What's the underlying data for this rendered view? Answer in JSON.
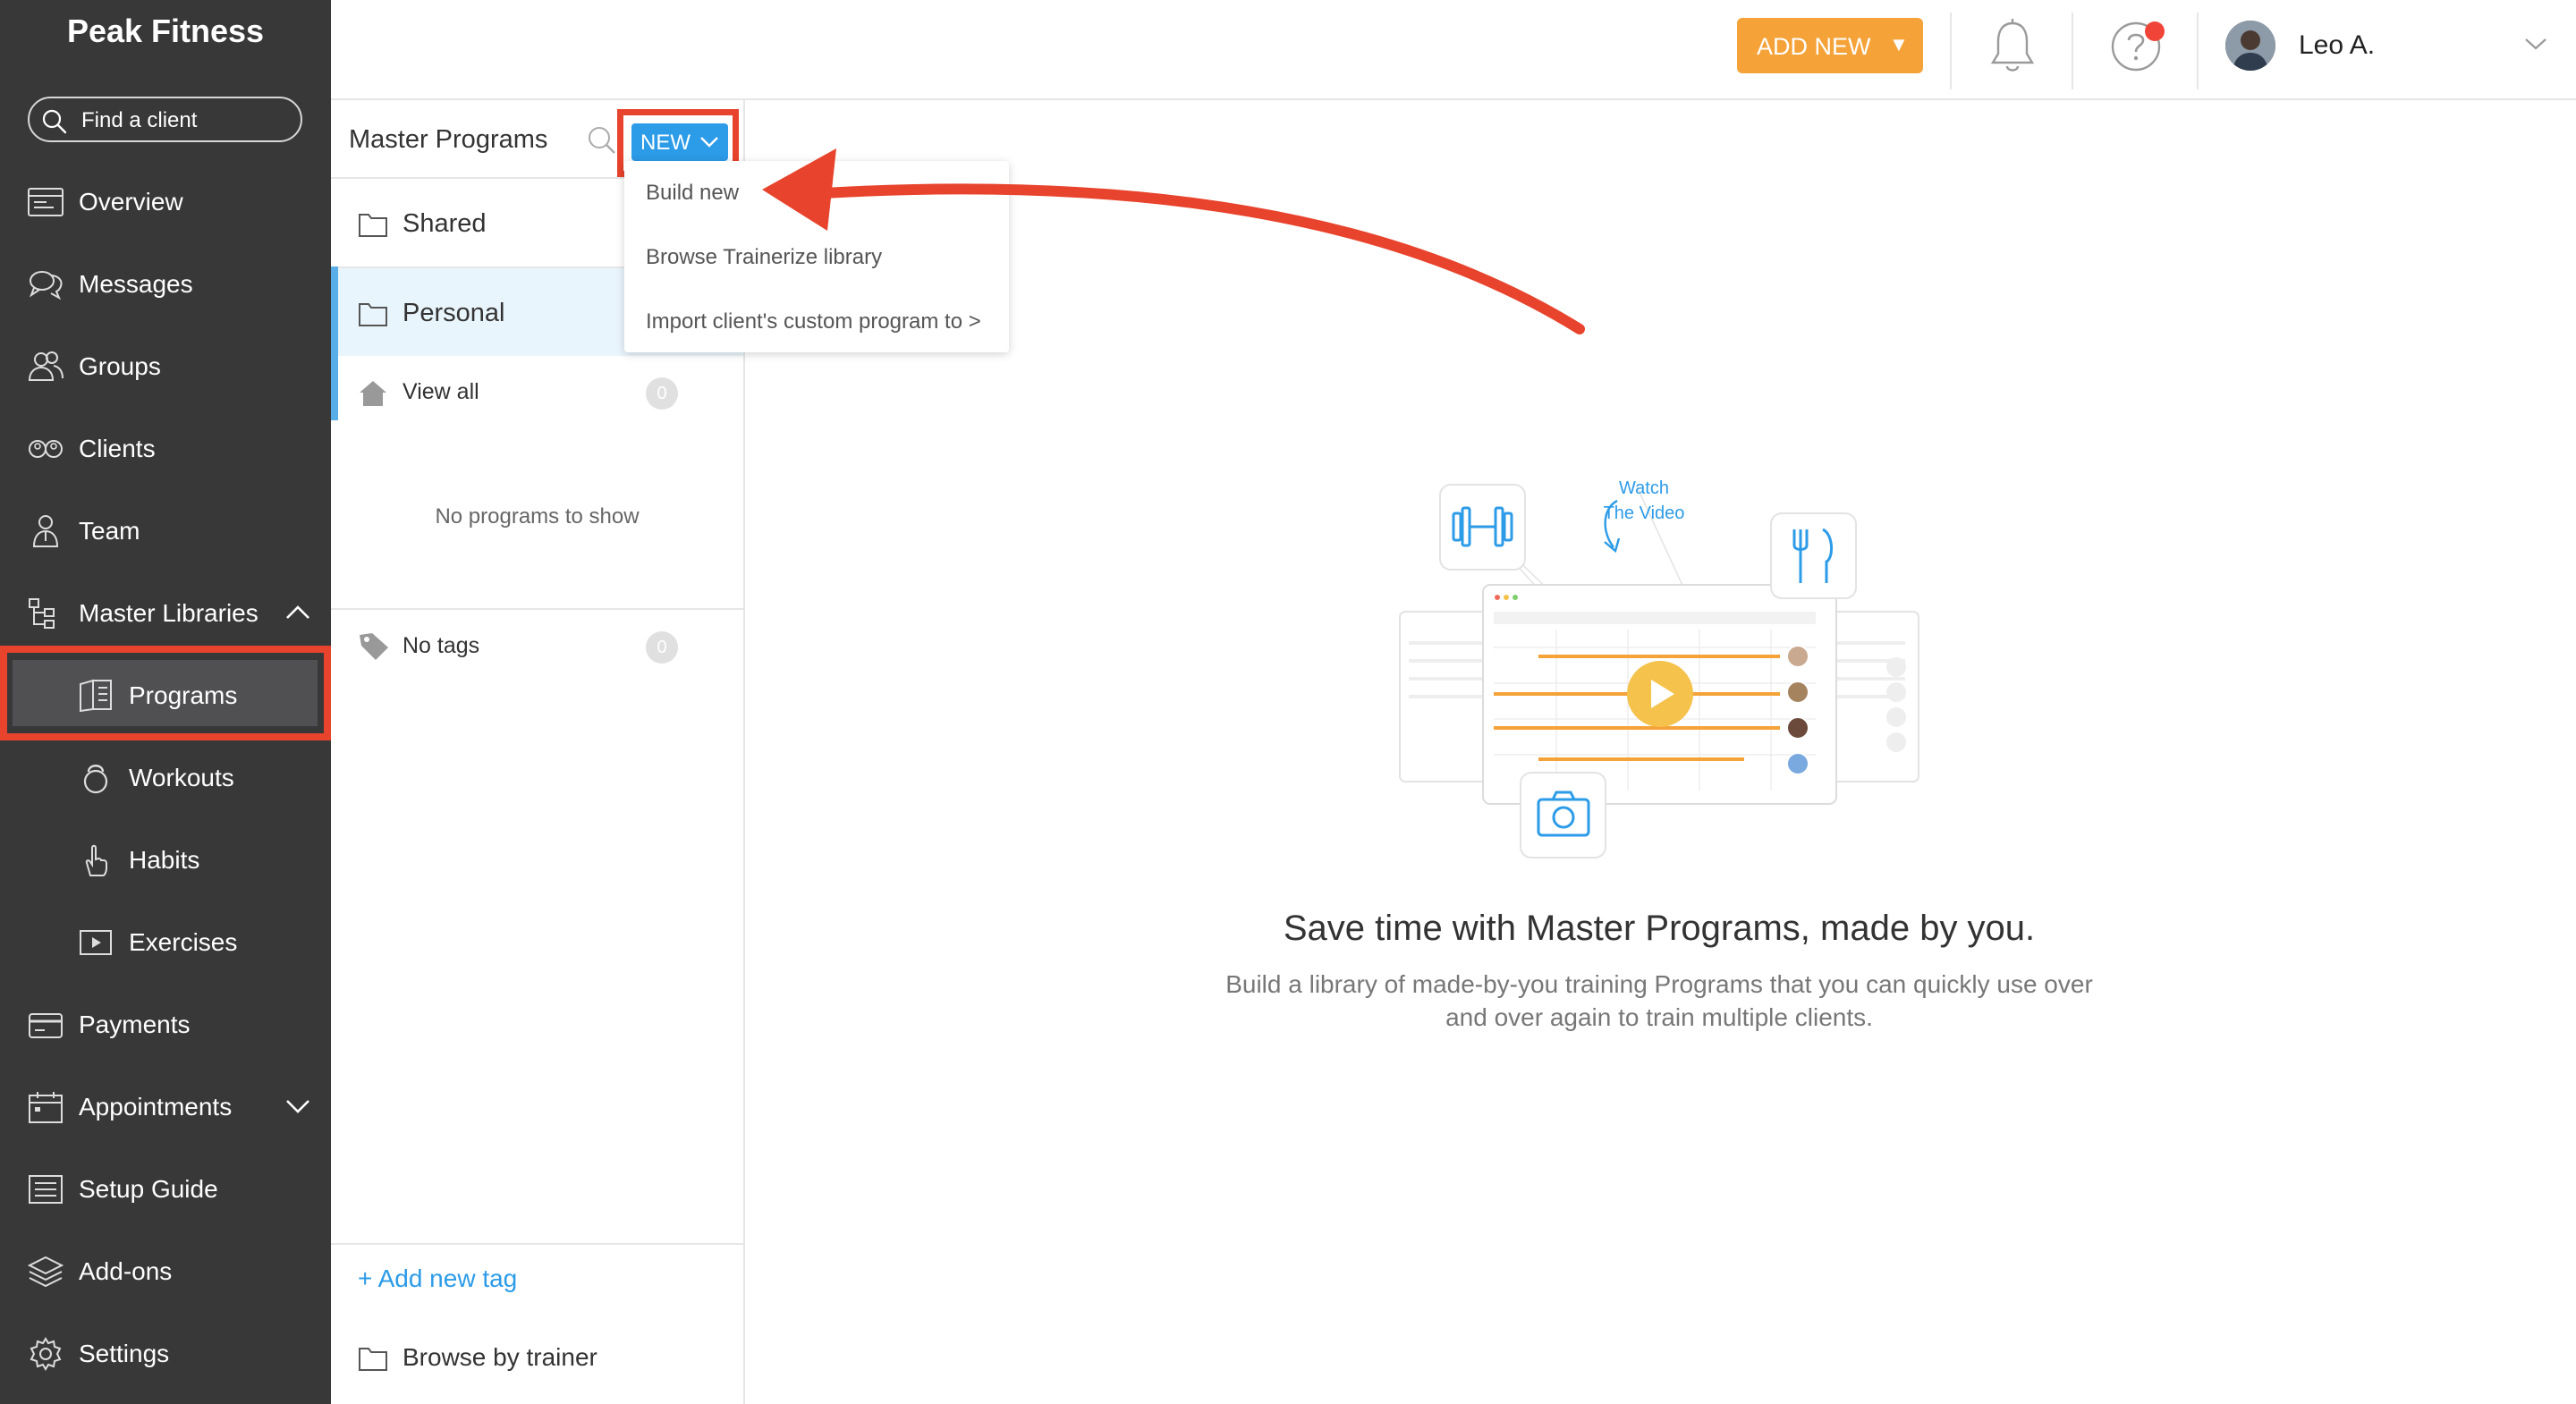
{
  "app": {
    "brand": "Peak Fitness"
  },
  "search": {
    "label": "Find a client"
  },
  "nav": {
    "overview": "Overview",
    "messages": "Messages",
    "groups": "Groups",
    "clients": "Clients",
    "team": "Team",
    "master_libraries": "Master Libraries",
    "programs": "Programs",
    "workouts": "Workouts",
    "habits": "Habits",
    "exercises": "Exercises",
    "payments": "Payments",
    "appointments": "Appointments",
    "setup_guide": "Setup Guide",
    "addons": "Add-ons",
    "settings": "Settings"
  },
  "topbar": {
    "add_new_label": "ADD NEW",
    "add_new_arrow": "▼",
    "user_name": "Leo A."
  },
  "panel": {
    "title": "Master Programs",
    "new_label": "NEW",
    "folders": {
      "shared": "Shared",
      "personal": "Personal"
    },
    "view_all": "View all",
    "view_all_count": "0",
    "empty_text": "No programs to show",
    "no_tags": "No tags",
    "no_tags_count": "0",
    "add_tag": "+ Add new tag",
    "browse_by_trainer": "Browse by trainer"
  },
  "dropdown": {
    "build_new": "Build new",
    "browse_library": "Browse Trainerize library",
    "import_custom": "Import client's custom program to",
    "import_chevron": ">"
  },
  "empty_state": {
    "watch_line1": "Watch",
    "watch_line2": "The Video",
    "title": "Save time with Master Programs, made by you.",
    "description_line1": "Build a library of made-by-you training Programs that you can quickly use over",
    "description_line2": "and over again to train multiple clients."
  },
  "colors": {
    "sidebar_bg": "#383839",
    "accent_orange": "#f5a238",
    "accent_blue": "#2c9be8",
    "highlight_red": "#e8432c",
    "notification_red": "#f04438",
    "selected_folder_bg": "#e9f5fc"
  },
  "icons": {
    "search": "search-icon",
    "overview": "overview-icon",
    "messages": "chat-bubbles-icon",
    "groups": "groups-icon",
    "clients": "clients-icon",
    "team": "team-icon",
    "master_libraries": "hierarchy-icon",
    "programs": "book-icon",
    "workouts": "kettlebell-icon",
    "habits": "hand-pointer-icon",
    "exercises": "video-play-icon",
    "payments": "credit-card-icon",
    "appointments": "calendar-icon",
    "setup_guide": "checklist-icon",
    "addons": "layers-icon",
    "settings": "gear-icon",
    "bell": "bell-icon",
    "help": "help-icon",
    "folder": "folder-icon",
    "home": "home-icon",
    "tag": "tag-icon"
  }
}
